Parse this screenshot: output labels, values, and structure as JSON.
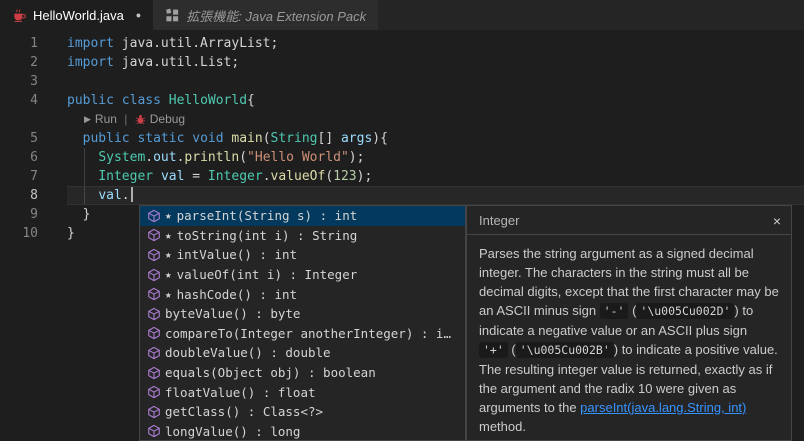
{
  "tabs": {
    "tab1": {
      "label": "HelloWorld.java",
      "modified_dot": "●"
    },
    "tab2": {
      "label": "拡張機能: Java Extension Pack"
    }
  },
  "editor": {
    "codelens": {
      "run_icon": "▶",
      "run": "Run",
      "separator": "|",
      "debug": "Debug"
    },
    "lines": [
      {
        "n": "1",
        "tokens": [
          [
            "kw",
            "import"
          ],
          [
            "pl",
            " java.util.ArrayList;"
          ]
        ]
      },
      {
        "n": "2",
        "tokens": [
          [
            "kw",
            "import"
          ],
          [
            "pl",
            " java.util.List;"
          ]
        ]
      },
      {
        "n": "3",
        "tokens": []
      },
      {
        "n": "4",
        "tokens": [
          [
            "kw",
            "public"
          ],
          [
            "pl",
            " "
          ],
          [
            "kw",
            "class"
          ],
          [
            "pl",
            " "
          ],
          [
            "ty",
            "HelloWorld"
          ],
          [
            "pl",
            "{"
          ]
        ]
      },
      {
        "n": "",
        "codelens": true
      },
      {
        "n": "5",
        "tokens": [
          [
            "pl",
            "  "
          ],
          [
            "kw",
            "public"
          ],
          [
            "pl",
            " "
          ],
          [
            "kw",
            "static"
          ],
          [
            "pl",
            " "
          ],
          [
            "kw",
            "void"
          ],
          [
            "pl",
            " "
          ],
          [
            "fn",
            "main"
          ],
          [
            "pl",
            "("
          ],
          [
            "ty",
            "String"
          ],
          [
            "pl",
            "[] "
          ],
          [
            "va",
            "args"
          ],
          [
            "pl",
            "){"
          ]
        ]
      },
      {
        "n": "6",
        "tokens": [
          [
            "pl",
            "    "
          ],
          [
            "ty",
            "System"
          ],
          [
            "pl",
            "."
          ],
          [
            "va",
            "out"
          ],
          [
            "pl",
            "."
          ],
          [
            "fn",
            "println"
          ],
          [
            "pl",
            "("
          ],
          [
            "st",
            "\"Hello World\""
          ],
          [
            "pl",
            ");"
          ]
        ]
      },
      {
        "n": "7",
        "tokens": [
          [
            "pl",
            "    "
          ],
          [
            "ty",
            "Integer"
          ],
          [
            "pl",
            " "
          ],
          [
            "va",
            "val"
          ],
          [
            "pl",
            " = "
          ],
          [
            "ty",
            "Integer"
          ],
          [
            "pl",
            "."
          ],
          [
            "fn",
            "valueOf"
          ],
          [
            "pl",
            "("
          ],
          [
            "nu",
            "123"
          ],
          [
            "pl",
            ");"
          ]
        ]
      },
      {
        "n": "8",
        "tokens": [
          [
            "pl",
            "    "
          ],
          [
            "va",
            "val"
          ],
          [
            "pl",
            "."
          ]
        ],
        "current": true,
        "cursor": true
      },
      {
        "n": "9",
        "tokens": [
          [
            "pl",
            "  }"
          ]
        ]
      },
      {
        "n": "10",
        "tokens": [
          [
            "pl",
            "}"
          ]
        ]
      }
    ]
  },
  "suggest": {
    "star_icon": "★",
    "items": [
      {
        "star": true,
        "selected": true,
        "label": "parseInt(String s) : int"
      },
      {
        "star": true,
        "label": "toString(int i) : String"
      },
      {
        "star": true,
        "label": "intValue() : int"
      },
      {
        "star": true,
        "label": "valueOf(int i) : Integer"
      },
      {
        "star": true,
        "label": "hashCode() : int"
      },
      {
        "star": false,
        "label": "byteValue() : byte"
      },
      {
        "star": false,
        "label": "compareTo(Integer anotherInteger) : i…"
      },
      {
        "star": false,
        "label": "doubleValue() : double"
      },
      {
        "star": false,
        "label": "equals(Object obj) : boolean"
      },
      {
        "star": false,
        "label": "floatValue() : float"
      },
      {
        "star": false,
        "label": "getClass() : Class<?>"
      },
      {
        "star": false,
        "label": "longValue() : long"
      }
    ]
  },
  "docs": {
    "title": "Integer",
    "close_icon": "×",
    "body": [
      {
        "t": "text",
        "s": "Parses the string argument as a signed decimal integer. The characters in the string must all be decimal digits, except that the first character may be an ASCII minus sign "
      },
      {
        "t": "code",
        "s": "'-'"
      },
      {
        "t": "text",
        "s": " ("
      },
      {
        "t": "code",
        "s": "'\\u005Cu002D'"
      },
      {
        "t": "text",
        "s": ") to indicate a negative value or an ASCII plus sign "
      },
      {
        "t": "code",
        "s": "'+'"
      },
      {
        "t": "text",
        "s": " ("
      },
      {
        "t": "code",
        "s": "'\\u005Cu002B'"
      },
      {
        "t": "text",
        "s": ") to indicate a positive value. The resulting integer value is returned, exactly as if the argument and the radix 10 were given as arguments to the "
      },
      {
        "t": "link",
        "s": "parseInt(java.lang.String, int)"
      },
      {
        "t": "text",
        "s": " method."
      }
    ]
  },
  "colors": {
    "keyword": "#569cd6",
    "type": "#4ec9b0",
    "function": "#dcdcaa",
    "string": "#ce9178",
    "number": "#b5cea8",
    "variable": "#9cdcfe",
    "selection": "#04395e",
    "method_icon": "#b180d7",
    "link": "#3794ff",
    "java_icon": "#cc3e44"
  }
}
